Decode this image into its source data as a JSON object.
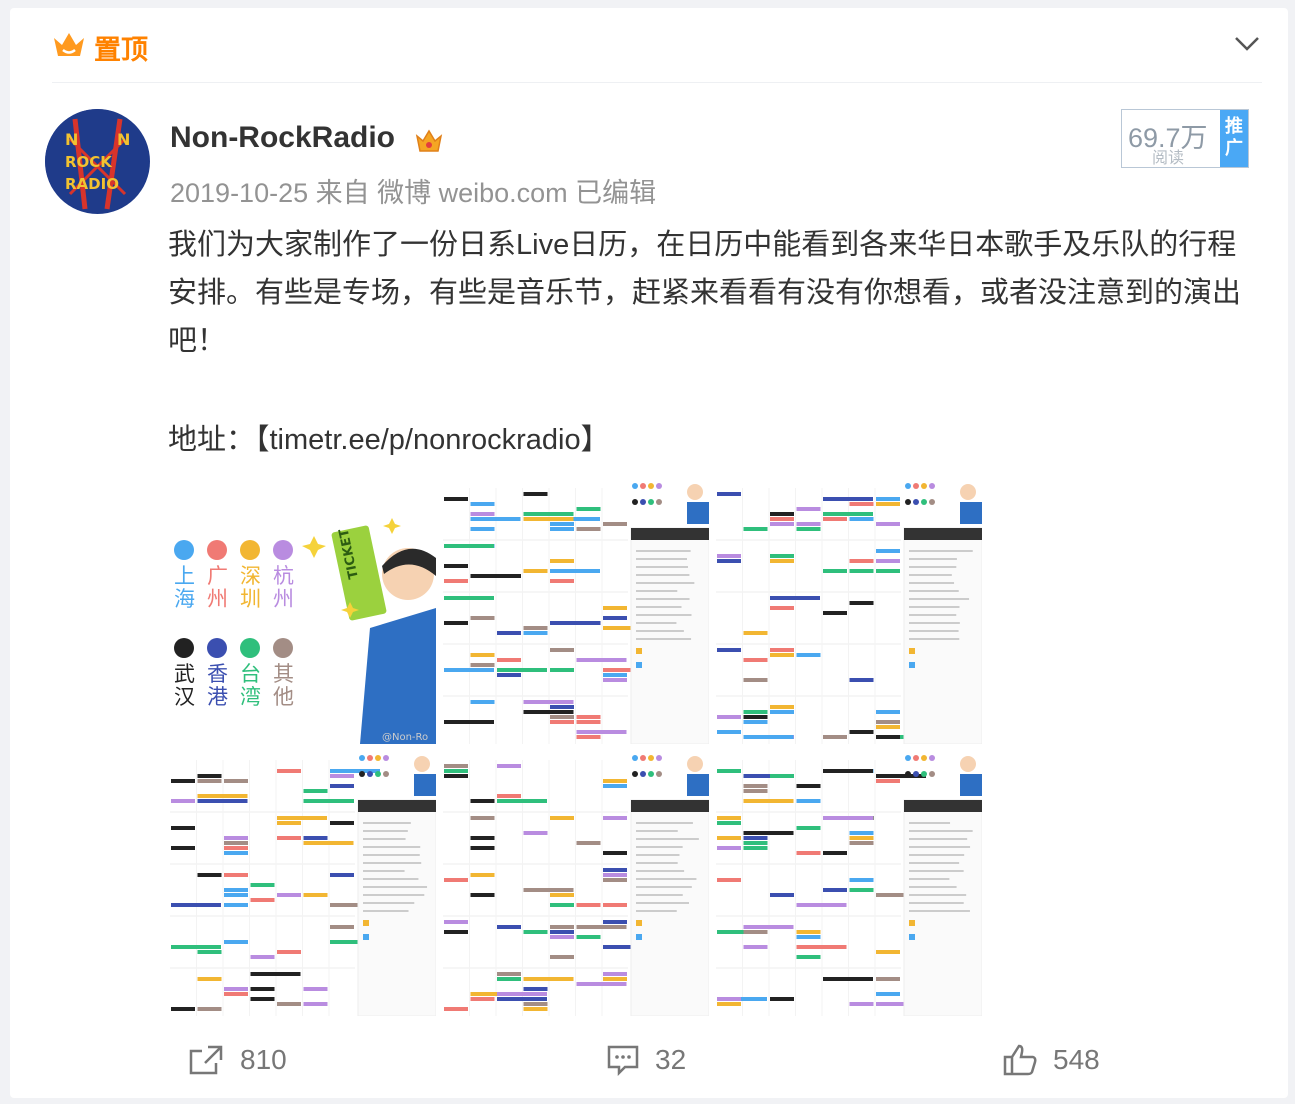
{
  "pin": {
    "label": "置顶"
  },
  "post": {
    "username": "Non-RockRadio",
    "meta": "2019-10-25 来自 微博 weibo.com 已编辑",
    "reads": {
      "count": "69.7万",
      "label": "阅读",
      "promo": "推广"
    },
    "text": "我们为大家制作了一份日系Live日历，在日历中能看到各来华日本歌手及乐队的行程安排。有些是专场，有些是音乐节，赶紧来看看有没有你想看，或者没注意到的演出吧！",
    "address": "地址：【timetr.ee/p/nonrockradio】",
    "avatar_text": [
      "N",
      "N",
      "ROCK",
      "RADIO"
    ]
  },
  "legend": {
    "cities": [
      {
        "name": "上海",
        "color": "#4aa8f0"
      },
      {
        "name": "广州",
        "color": "#f07a74"
      },
      {
        "name": "深圳",
        "color": "#f2b632"
      },
      {
        "name": "杭州",
        "color": "#b98ce0"
      },
      {
        "name": "武汉",
        "color": "#222222"
      },
      {
        "name": "香港",
        "color": "#3b4fb0"
      },
      {
        "name": "台湾",
        "color": "#2fbf7c"
      },
      {
        "name": "其他",
        "color": "#a38d85"
      }
    ],
    "ticket": "TICKET",
    "watermark": "@Non-Ro"
  },
  "actions": {
    "share": "810",
    "comment": "32",
    "like": "548"
  },
  "colors": {
    "brand_orange": "#ff8200",
    "text": "#333333",
    "meta": "#939393",
    "promo": "#4aa8f5"
  }
}
